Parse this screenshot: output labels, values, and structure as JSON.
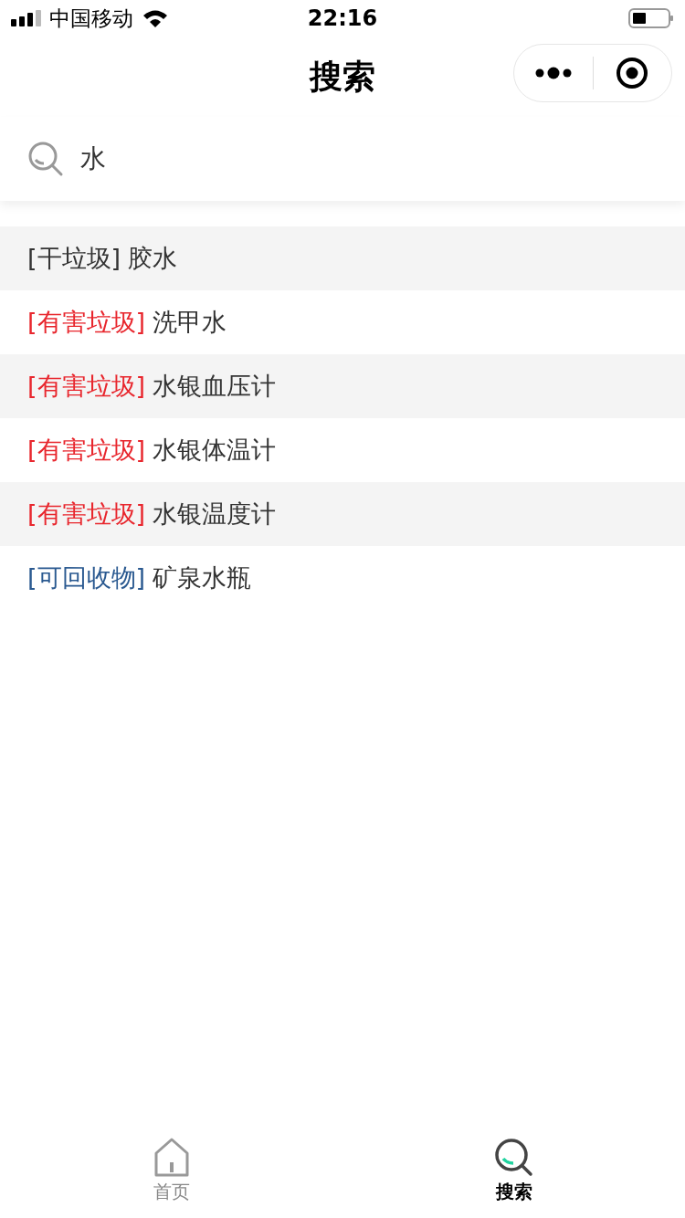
{
  "status_bar": {
    "carrier": "中国移动",
    "time": "22:16"
  },
  "nav": {
    "title": "搜索"
  },
  "search": {
    "value": "水"
  },
  "results": [
    {
      "category": "[干垃圾]",
      "color": "#333333",
      "name": "胶水"
    },
    {
      "category": "[有害垃圾]",
      "color": "#e8262d",
      "name": "洗甲水"
    },
    {
      "category": "[有害垃圾]",
      "color": "#e8262d",
      "name": "水银血压计"
    },
    {
      "category": "[有害垃圾]",
      "color": "#e8262d",
      "name": "水银体温计"
    },
    {
      "category": "[有害垃圾]",
      "color": "#e8262d",
      "name": "水银温度计"
    },
    {
      "category": "[可回收物]",
      "color": "#2a5990",
      "name": "矿泉水瓶"
    }
  ],
  "tabs": [
    {
      "kind": "home",
      "label": "首页",
      "selected": false
    },
    {
      "kind": "search",
      "label": "搜索",
      "selected": true
    }
  ]
}
